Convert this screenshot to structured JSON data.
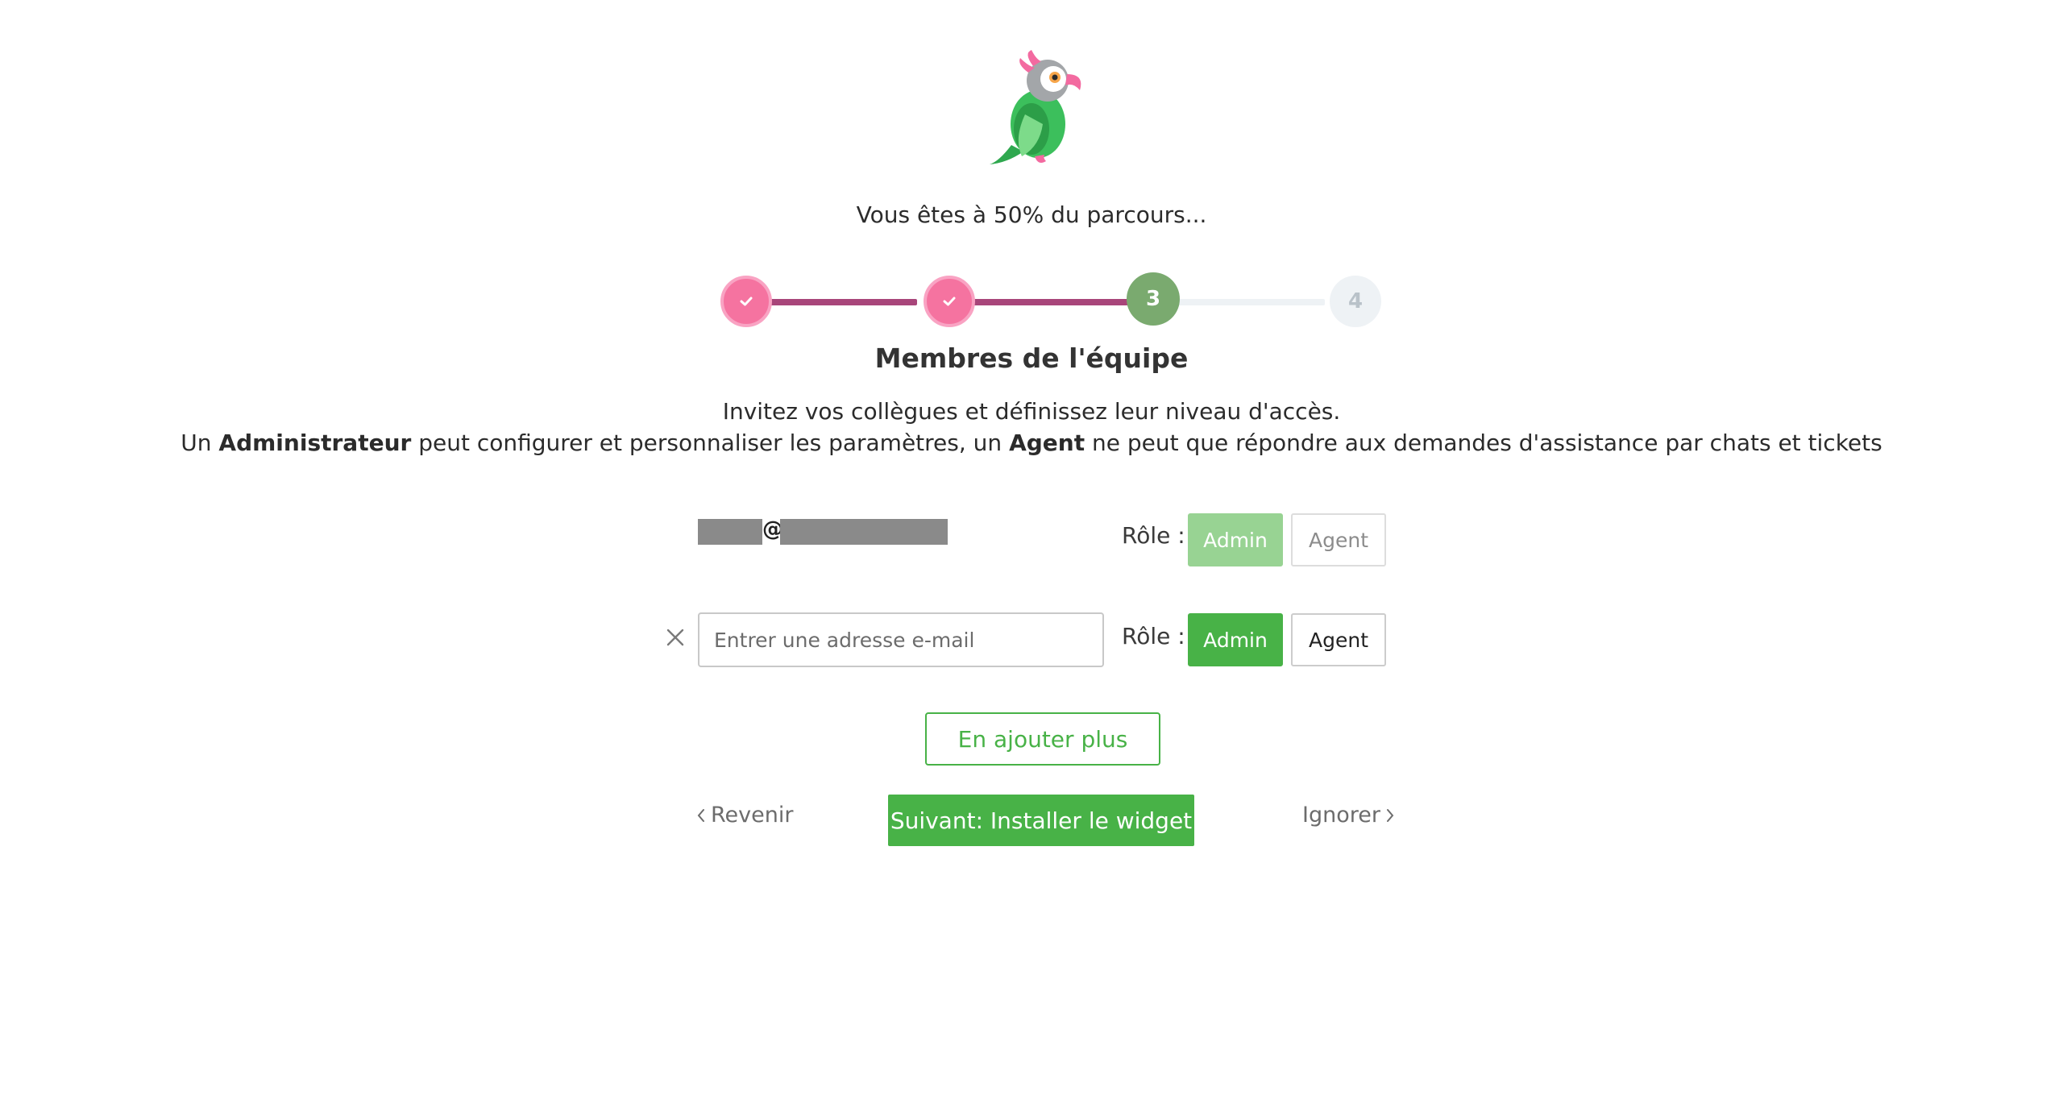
{
  "header": {
    "logo": "parrot-logo",
    "progress_text": "Vous êtes à 50% du parcours..."
  },
  "stepper": {
    "steps": [
      {
        "label": "✓",
        "state": "done"
      },
      {
        "label": "✓",
        "state": "done"
      },
      {
        "label": "3",
        "state": "current"
      },
      {
        "label": "4",
        "state": "todo"
      }
    ],
    "progress_percent": 50
  },
  "content": {
    "title": "Membres de l'équipe",
    "line1": "Invitez vos collègues et définissez leur niveau d'accès.",
    "line2_parts": {
      "p1": "Un ",
      "b1": "Administrateur",
      "p2": " peut configurer et personnaliser les paramètres, un ",
      "b2": "Agent",
      "p3": " ne peut que répondre aux demandes d'assistance par chats et tickets"
    }
  },
  "members": [
    {
      "email_at": "@",
      "role_label": "Rôle :",
      "admin_label": "Admin",
      "agent_label": "Agent",
      "selected": "Admin",
      "editable": false
    },
    {
      "placeholder": "Entrer une adresse e-mail",
      "value": "",
      "role_label": "Rôle :",
      "admin_label": "Admin",
      "agent_label": "Agent",
      "selected": "Admin",
      "editable": true
    }
  ],
  "actions": {
    "add_more": "En ajouter plus",
    "back": "Revenir",
    "next": "Suivant: Installer le widget",
    "skip": "Ignorer"
  },
  "colors": {
    "brand_green": "#48b247",
    "step_done_pink": "#f573a0",
    "step_line_done": "#a8457a",
    "step_current_green": "#7aaa6f",
    "step_todo": "#eef2f5"
  }
}
